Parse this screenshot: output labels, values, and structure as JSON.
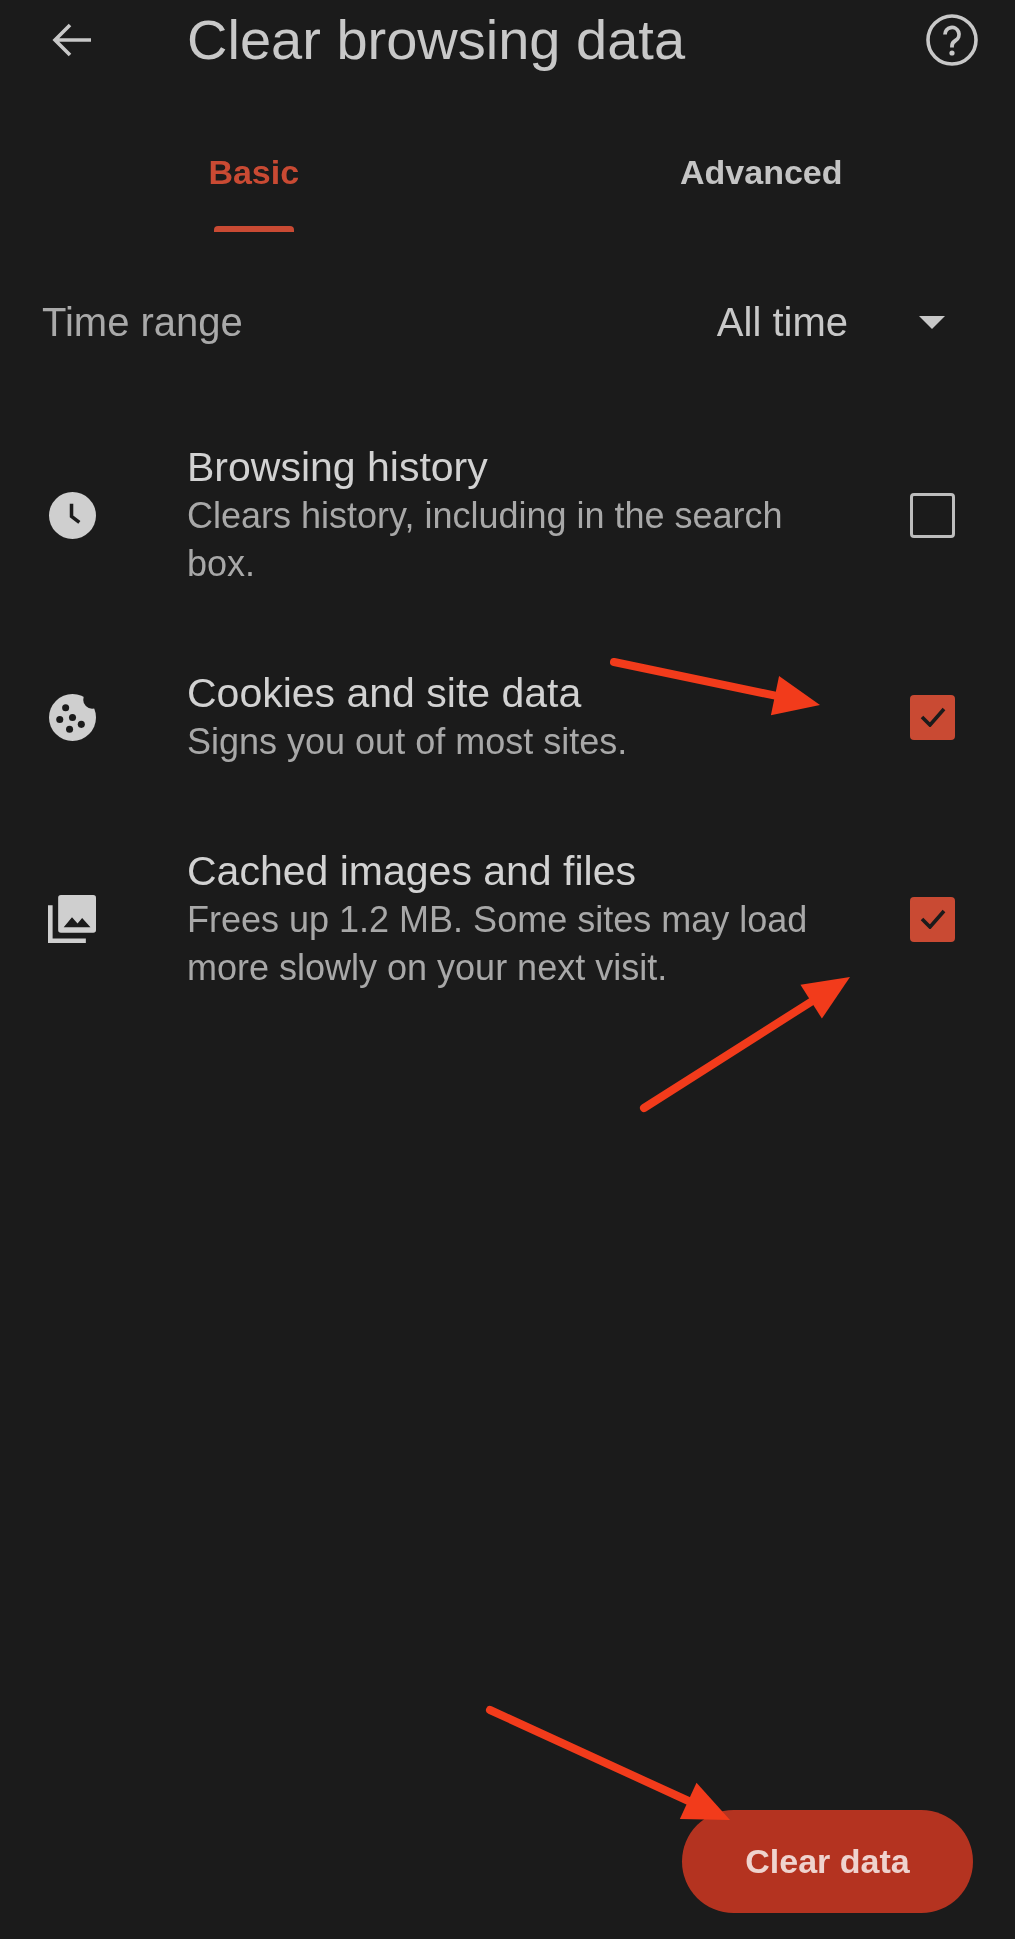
{
  "header": {
    "title": "Clear browsing data"
  },
  "tabs": [
    {
      "label": "Basic",
      "selected": true
    },
    {
      "label": "Advanced",
      "selected": false
    }
  ],
  "time_range": {
    "label": "Time range",
    "value": "All time"
  },
  "items": [
    {
      "title": "Browsing history",
      "description": "Clears history, including in the search box.",
      "checked": false
    },
    {
      "title": "Cookies and site data",
      "description": "Signs you out of most sites.",
      "checked": true
    },
    {
      "title": "Cached images and files",
      "description": "Frees up 1.2 MB. Some sites may load more slowly on your next visit.",
      "checked": true
    }
  ],
  "action_button": {
    "label": "Clear data"
  }
}
